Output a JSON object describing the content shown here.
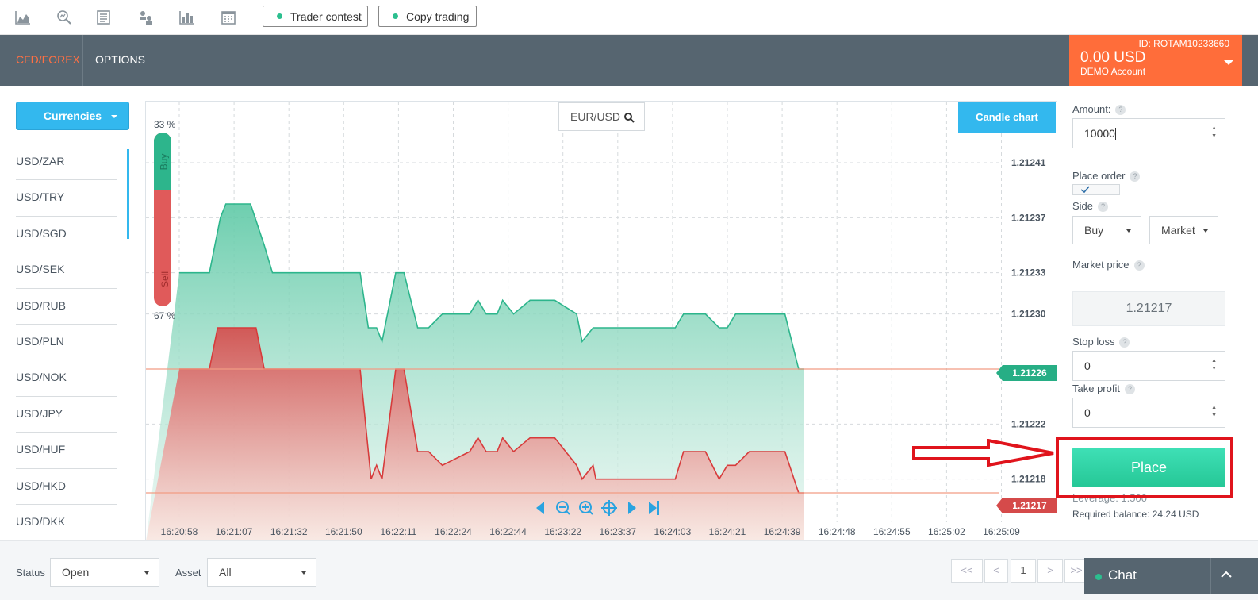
{
  "toolbar": {
    "icons": [
      "area-chart-icon",
      "search-chart-icon",
      "document-icon",
      "users-icon",
      "bar-chart-icon",
      "calendar-icon"
    ],
    "trader_contest_label": "Trader contest",
    "copy_trading_label": "Copy trading"
  },
  "topnav": {
    "tab_cfd": "CFD/FOREX",
    "tab_options": "OPTIONS",
    "account_id": "ID: ROTAM10233660",
    "balance": "0.00 USD",
    "account_type": "DEMO Account"
  },
  "sidebar": {
    "category_button": "Currencies",
    "pairs": [
      "USD/ZAR",
      "USD/TRY",
      "USD/SGD",
      "USD/SEK",
      "USD/RUB",
      "USD/PLN",
      "USD/NOK",
      "USD/JPY",
      "USD/HUF",
      "USD/HKD",
      "USD/DKK"
    ]
  },
  "chart": {
    "symbol": "EUR/USD",
    "chart_type_button": "Candle chart",
    "sentiment": {
      "buy_pct": "33 %",
      "sell_pct": "67 %",
      "buy_label": "Buy",
      "sell_label": "Sell",
      "buy_fraction": 0.33
    },
    "price_badges": {
      "ask": "1.21226",
      "bid": "1.21217"
    }
  },
  "chart_data": {
    "type": "area",
    "title": "",
    "xlabel": "",
    "ylabel": "",
    "x_ticks": [
      "16:20:58",
      "16:21:07",
      "16:21:32",
      "16:21:50",
      "16:22:11",
      "16:22:24",
      "16:22:44",
      "16:23:22",
      "16:23:37",
      "16:24:03",
      "16:24:21",
      "16:24:39",
      "16:24:48",
      "16:24:55",
      "16:25:02",
      "16:25:09"
    ],
    "y_ticks": [
      "1.21241",
      "1.21237",
      "1.21233",
      "1.21230",
      "1.21226",
      "1.21222",
      "1.21218",
      "1.21217"
    ],
    "ylim": [
      1.21214,
      1.21244
    ],
    "series": [
      {
        "color": "#2db58c",
        "x": [
          0,
          0.55,
          0.75,
          0.85,
          1.3,
          1.55,
          1.7,
          2.0,
          3.3,
          3.45,
          3.6,
          3.7,
          3.95,
          4.1,
          4.35,
          4.55,
          4.8,
          5.3,
          5.45,
          5.6,
          5.8,
          5.9,
          6.1,
          6.4,
          6.5,
          6.65,
          6.85,
          7.25,
          7.35,
          7.55,
          7.6,
          9.05,
          9.2,
          9.6,
          9.85,
          10.0,
          10.15,
          10.4,
          10.5,
          10.95,
          11.05,
          11.3,
          11.4
        ],
        "y": [
          1.21233,
          1.21233,
          1.21237,
          1.21238,
          1.21238,
          1.21235,
          1.21233,
          1.21233,
          1.21233,
          1.21229,
          1.21229,
          1.21228,
          1.21233,
          1.21233,
          1.21229,
          1.21229,
          1.2123,
          1.2123,
          1.21231,
          1.2123,
          1.2123,
          1.21231,
          1.2123,
          1.21231,
          1.21231,
          1.21231,
          1.21231,
          1.2123,
          1.21228,
          1.21229,
          1.21229,
          1.21229,
          1.2123,
          1.2123,
          1.21229,
          1.21229,
          1.2123,
          1.2123,
          1.2123,
          1.2123,
          1.2123,
          1.21226,
          1.21226
        ]
      },
      {
        "color": "#d73b3b",
        "x": [
          0,
          0.55,
          0.7,
          0.85,
          1.4,
          1.55,
          1.7,
          2.0,
          3.3,
          3.5,
          3.6,
          3.7,
          3.95,
          4.1,
          4.35,
          4.55,
          4.8,
          5.3,
          5.45,
          5.6,
          5.8,
          5.9,
          6.1,
          6.4,
          6.5,
          6.65,
          6.85,
          7.25,
          7.35,
          7.55,
          7.6,
          9.05,
          9.2,
          9.6,
          9.85,
          10.0,
          10.15,
          10.4,
          10.5,
          10.95,
          11.05,
          11.3,
          11.4
        ],
        "y": [
          1.21226,
          1.21226,
          1.21229,
          1.21229,
          1.21229,
          1.21226,
          1.21226,
          1.21226,
          1.21226,
          1.21218,
          1.21219,
          1.21218,
          1.21226,
          1.21226,
          1.2122,
          1.2122,
          1.21219,
          1.2122,
          1.21221,
          1.2122,
          1.2122,
          1.21221,
          1.2122,
          1.21221,
          1.21221,
          1.21221,
          1.21221,
          1.21219,
          1.21218,
          1.21219,
          1.21218,
          1.21218,
          1.2122,
          1.2122,
          1.21218,
          1.21219,
          1.21219,
          1.2122,
          1.2122,
          1.2122,
          1.2122,
          1.21217,
          1.21217
        ]
      }
    ]
  },
  "order": {
    "amount_label": "Amount:",
    "amount_value": "10000",
    "place_order_label": "Place order",
    "side_label": "Side",
    "side_value": "Buy",
    "order_type_value": "Market",
    "market_price_label": "Market price",
    "market_price_value": "1.21217",
    "stop_loss_label": "Stop loss",
    "stop_loss_value": "0",
    "take_profit_label": "Take profit",
    "take_profit_value": "0",
    "place_button": "Place",
    "leverage_text": "Leverage: 1:500",
    "required_balance": "Required balance: 24.24 USD",
    "help_glyph": "?"
  },
  "bottom": {
    "status_label": "Status",
    "status_value": "Open",
    "asset_label": "Asset",
    "asset_value": "All",
    "pager": [
      "<<",
      "<",
      "1",
      ">",
      ">>"
    ],
    "chat_label": "Chat"
  }
}
